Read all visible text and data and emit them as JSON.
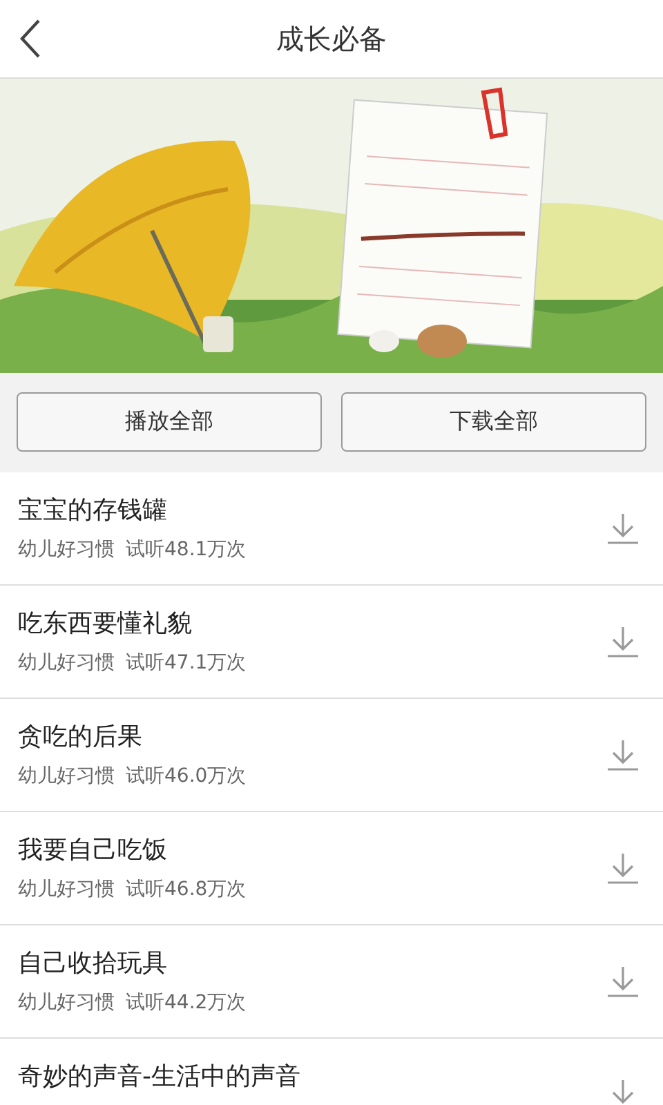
{
  "header": {
    "title": "成长必备"
  },
  "actions": [
    "播放全部",
    "下载全部"
  ],
  "tracks": [
    {
      "title": "宝宝的存钱罐",
      "category": "幼儿好习惯",
      "plays": "试听48.1万次"
    },
    {
      "title": "吃东西要懂礼貌",
      "category": "幼儿好习惯",
      "plays": "试听47.1万次"
    },
    {
      "title": "贪吃的后果",
      "category": "幼儿好习惯",
      "plays": "试听46.0万次"
    },
    {
      "title": "我要自己吃饭",
      "category": "幼儿好习惯",
      "plays": "试听46.8万次"
    },
    {
      "title": "自己收拾玩具",
      "category": "幼儿好习惯",
      "plays": "试听44.2万次"
    },
    {
      "title": "奇妙的声音-生活中的声音"
    }
  ]
}
